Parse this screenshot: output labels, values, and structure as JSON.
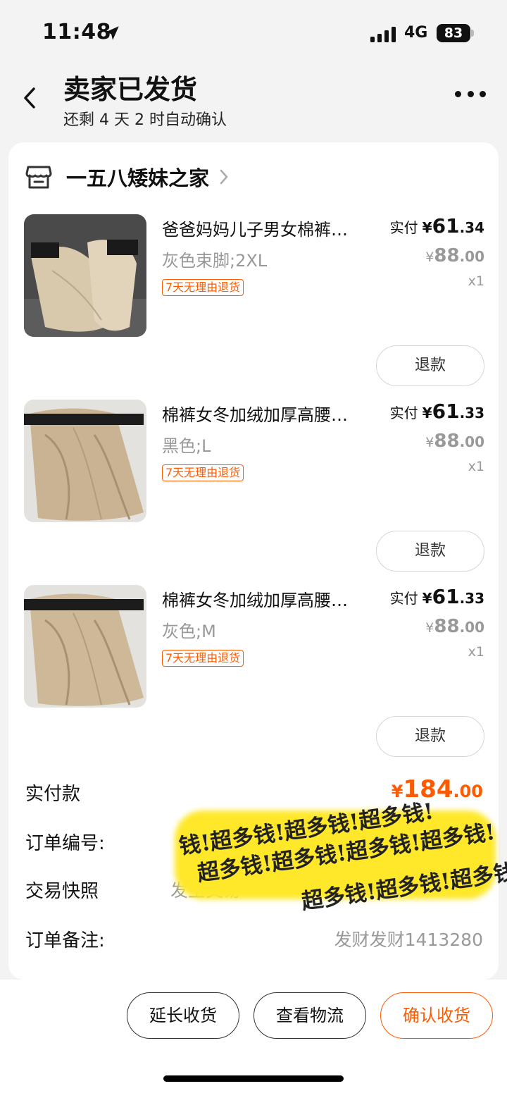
{
  "status_bar": {
    "time": "11:48",
    "network": "4G",
    "battery": "83"
  },
  "header": {
    "title": "卖家已发货",
    "subtitle": "还剩 4 天 2 时自动确认"
  },
  "shop": {
    "name": "一五八矮妹之家",
    "icon": "store-icon"
  },
  "items": [
    {
      "title": "爸爸妈妈儿子男女棉裤…",
      "variant": "灰色束脚;2XL",
      "tag": "7天无理由退货",
      "paid_label": "实付",
      "paid_currency": "¥",
      "paid_int": "61",
      "paid_dec": ".34",
      "orig_currency": "¥",
      "orig_int": "88",
      "orig_dec": ".00",
      "qty": "x1",
      "refund_label": "退款"
    },
    {
      "title": "棉裤女冬加绒加厚高腰…",
      "variant": "黑色;L",
      "tag": "7天无理由退货",
      "paid_label": "实付",
      "paid_currency": "¥",
      "paid_int": "61",
      "paid_dec": ".33",
      "orig_currency": "¥",
      "orig_int": "88",
      "orig_dec": ".00",
      "qty": "x1",
      "refund_label": "退款"
    },
    {
      "title": "棉裤女冬加绒加厚高腰…",
      "variant": "灰色;M",
      "tag": "7天无理由退货",
      "paid_label": "实付",
      "paid_currency": "¥",
      "paid_int": "61",
      "paid_dec": ".33",
      "orig_currency": "¥",
      "orig_int": "88",
      "orig_dec": ".00",
      "qty": "x1",
      "refund_label": "退款"
    }
  ],
  "summary": {
    "total_label": "实付款",
    "total_currency": "¥",
    "total_int": "184",
    "total_dec": ".00",
    "order_no_label": "订单编号:",
    "snapshot_label": "交易快照",
    "snapshot_value": "发生交易",
    "remark_label": "订单备注:",
    "remark_value": "发财发财1413280"
  },
  "sticker": {
    "line1": "钱!超多钱!超多钱!超多钱!",
    "line2": "超多钱!超多钱!超多钱!超多钱!",
    "line3": "超多钱!超多钱!超多钱!"
  },
  "bottom_bar": {
    "extend_label": "延长收货",
    "logistics_label": "查看物流",
    "confirm_label": "确认收货"
  },
  "colors": {
    "accent": "#ff5a00",
    "sticker": "#ffe82a"
  }
}
